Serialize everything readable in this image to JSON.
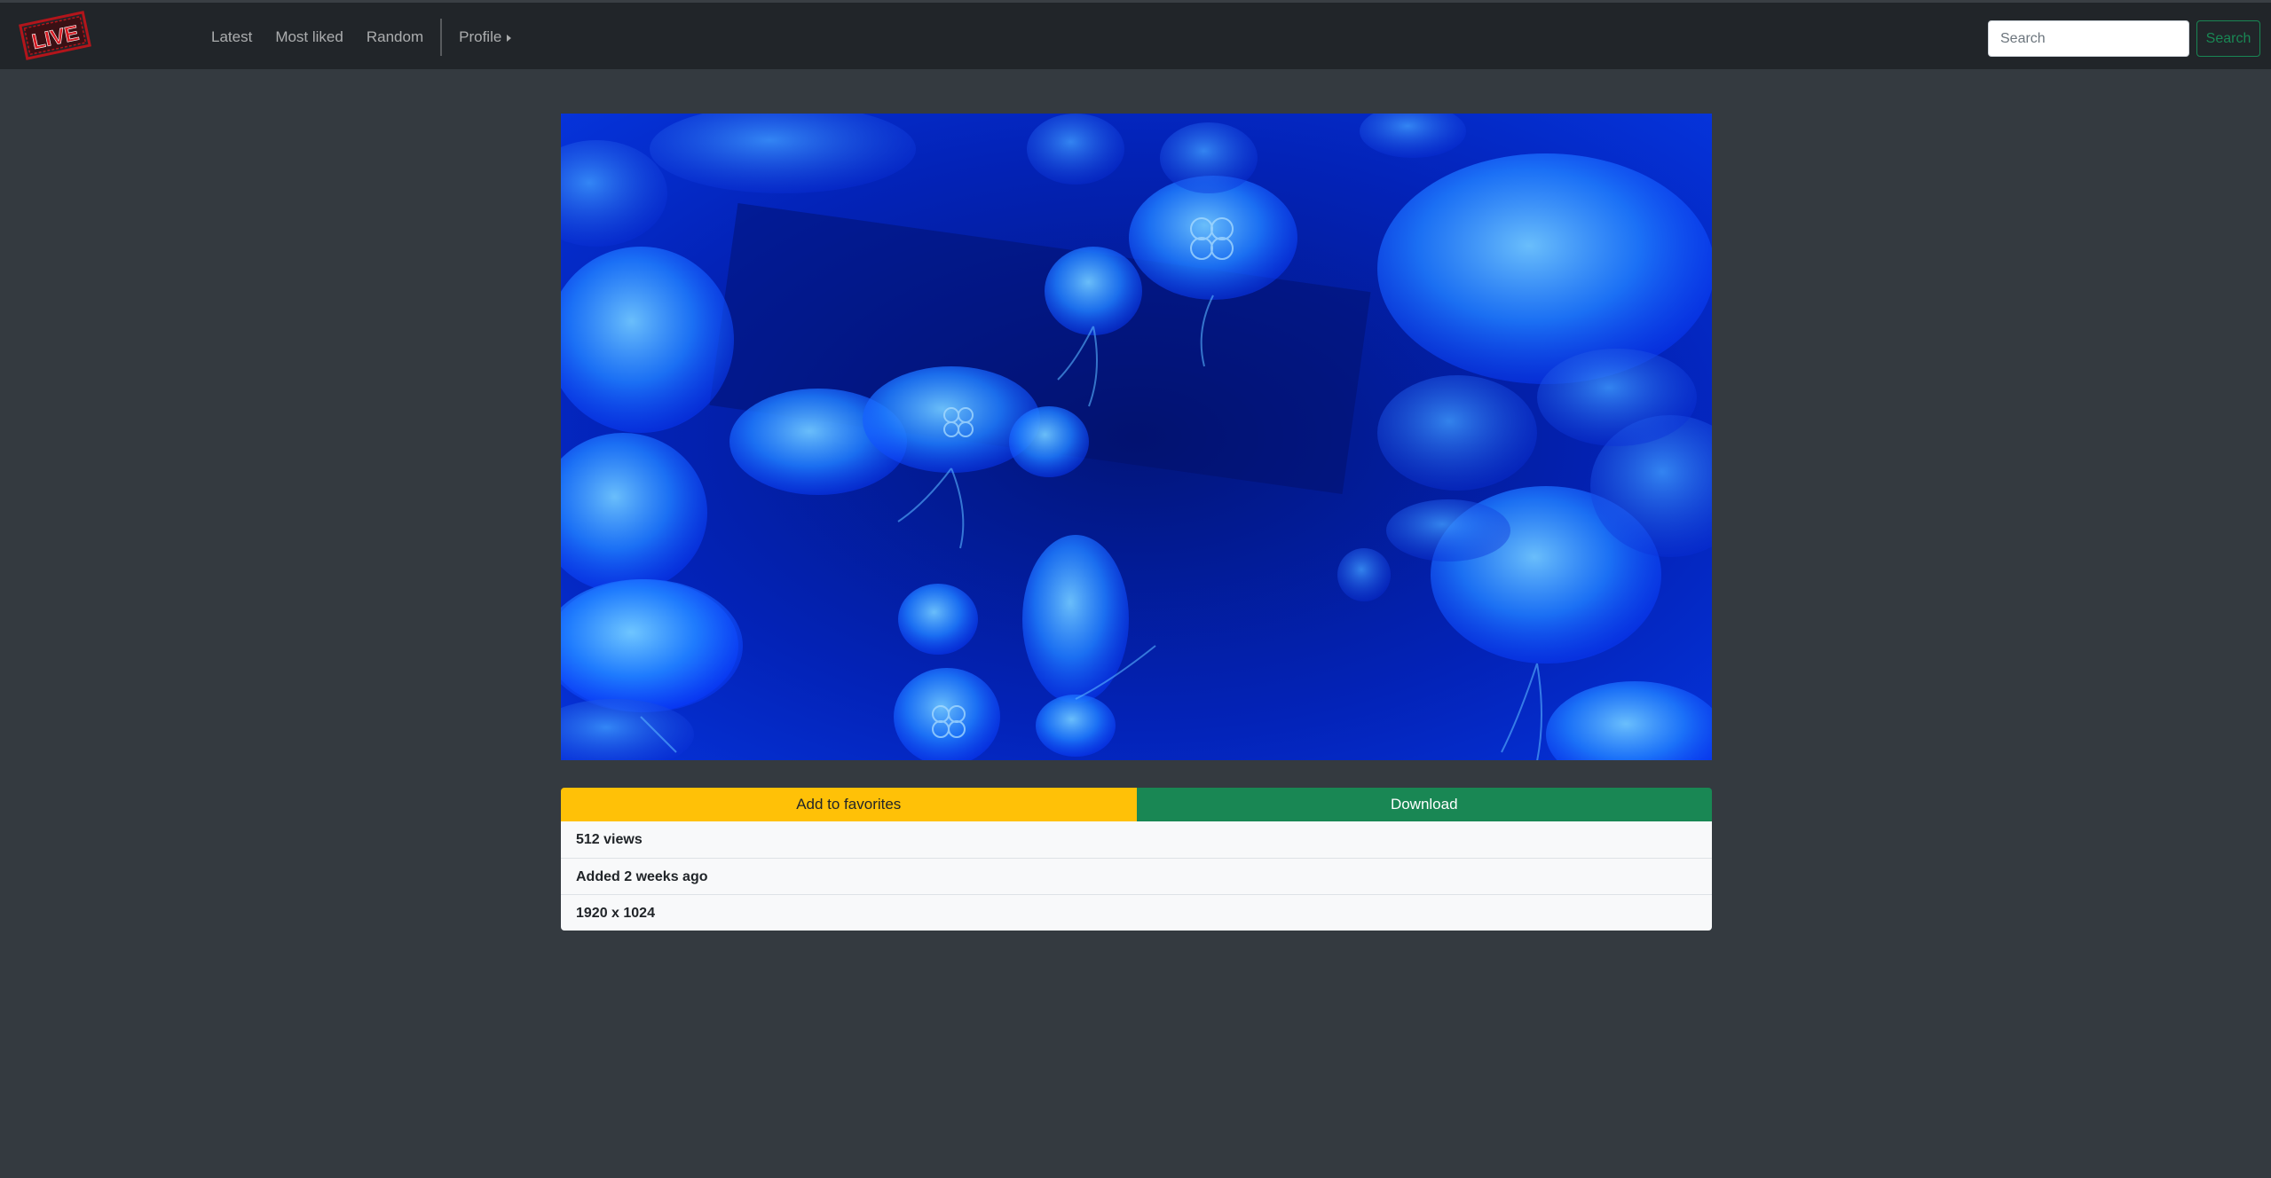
{
  "logo": {
    "text": "LIVE",
    "color": "#c8161d"
  },
  "nav": {
    "links": [
      {
        "label": "Latest"
      },
      {
        "label": "Most liked"
      },
      {
        "label": "Random"
      }
    ],
    "profile_label": "Profile"
  },
  "search": {
    "placeholder": "Search",
    "button_label": "Search"
  },
  "photo": {
    "subject": "blue jellyfish image",
    "icon": "photo"
  },
  "actions": {
    "favorite_label": "Add to favorites",
    "download_label": "Download"
  },
  "info": {
    "views": "512 views",
    "added": "Added 2 weeks ago",
    "dimensions": "1920 x 1024"
  },
  "colors": {
    "page_bg": "#343a40",
    "navbar_bg": "#212529",
    "favorite": "#ffc107",
    "download": "#198754",
    "search_outline": "#198754"
  }
}
